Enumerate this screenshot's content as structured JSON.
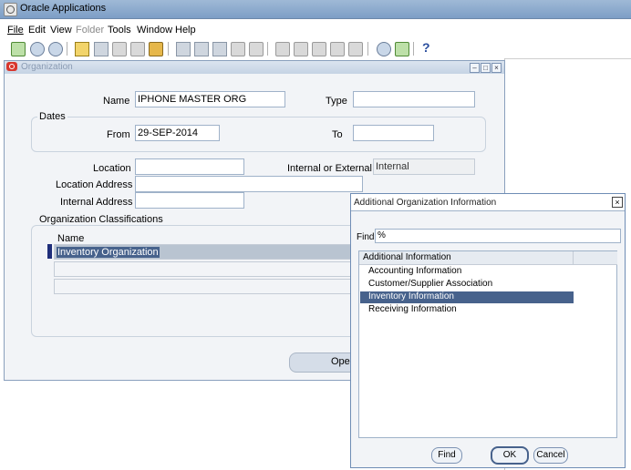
{
  "app": {
    "title": "Oracle Applications"
  },
  "menu": [
    {
      "label": "File",
      "disabled": false
    },
    {
      "label": "Edit",
      "disabled": false
    },
    {
      "label": "View",
      "disabled": false
    },
    {
      "label": "Folder",
      "disabled": true
    },
    {
      "label": "Tools",
      "disabled": false
    },
    {
      "label": "Window",
      "disabled": false
    },
    {
      "label": "Help",
      "disabled": false
    }
  ],
  "toolbar": {
    "help_glyph": "?"
  },
  "org_window": {
    "title": "Organization",
    "name_label": "Name",
    "name_value": "IPHONE MASTER ORG",
    "type_label": "Type",
    "type_value": "",
    "dates_group_label": "Dates",
    "from_label": "From",
    "from_value": "29-SEP-2014",
    "to_label": "To",
    "to_value": "",
    "location_label": "Location",
    "location_value": "",
    "int_ext_label": "Internal or External",
    "int_ext_value": "Internal",
    "location_address_label": "Location Address",
    "location_address_value": "",
    "internal_address_label": "Internal Address",
    "internal_address_value": "",
    "classifications_label": "Organization Classifications",
    "name_column": "Name",
    "classification_rows": [
      "Inventory Organization",
      "",
      ""
    ],
    "open_button_label": "Open"
  },
  "dialog": {
    "title": "Additional Organization Information",
    "find_label": "Find",
    "find_value": "%",
    "list_header": "Additional Information",
    "items": [
      "Accounting Information",
      "Customer/Supplier Association",
      "Inventory Information",
      "Receiving Information"
    ],
    "selected_index": 2,
    "find_button": "Find",
    "ok_button": "OK",
    "cancel_button": "Cancel"
  },
  "colors": {
    "selection": "#47628c",
    "title_bar": "#7d9ec6",
    "row_marker": "#1f2e7a"
  }
}
